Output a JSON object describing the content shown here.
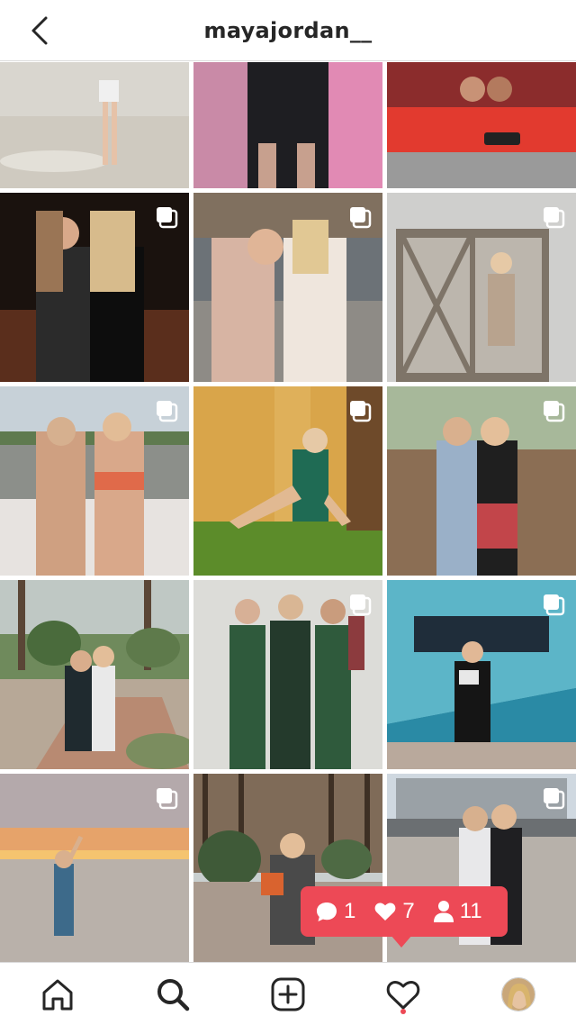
{
  "header": {
    "username": "mayajordan__"
  },
  "icons": {
    "back": "chevron-left-icon",
    "multi": "carousel-icon",
    "home": "home-icon",
    "search": "search-icon",
    "add": "add-post-icon",
    "activity": "heart-icon",
    "profile": "avatar"
  },
  "activity_popup": {
    "comments": "1",
    "likes": "7",
    "follows": "11"
  },
  "colors": {
    "accent": "#ed4956",
    "text": "#262626",
    "border": "#dbdbdb"
  },
  "grid": {
    "tiles": [
      {
        "name": "beach-girl",
        "multi": false
      },
      {
        "name": "pink-room-girl",
        "multi": false
      },
      {
        "name": "hot-tub-girls",
        "multi": false
      },
      {
        "name": "night-deck-girls",
        "multi": true
      },
      {
        "name": "street-girls",
        "multi": true
      },
      {
        "name": "barn-door-girl",
        "multi": true
      },
      {
        "name": "boat-girls",
        "multi": true
      },
      {
        "name": "autumn-stretch-girl",
        "multi": true
      },
      {
        "name": "forest-girls",
        "multi": true
      },
      {
        "name": "garden-path-duo",
        "multi": false
      },
      {
        "name": "green-leotard-trio",
        "multi": true
      },
      {
        "name": "revive-banner-girl",
        "multi": true
      },
      {
        "name": "sunset-beach-girl",
        "multi": true
      },
      {
        "name": "pine-forest-child",
        "multi": false
      },
      {
        "name": "city-plaza-duo",
        "multi": true
      }
    ]
  }
}
